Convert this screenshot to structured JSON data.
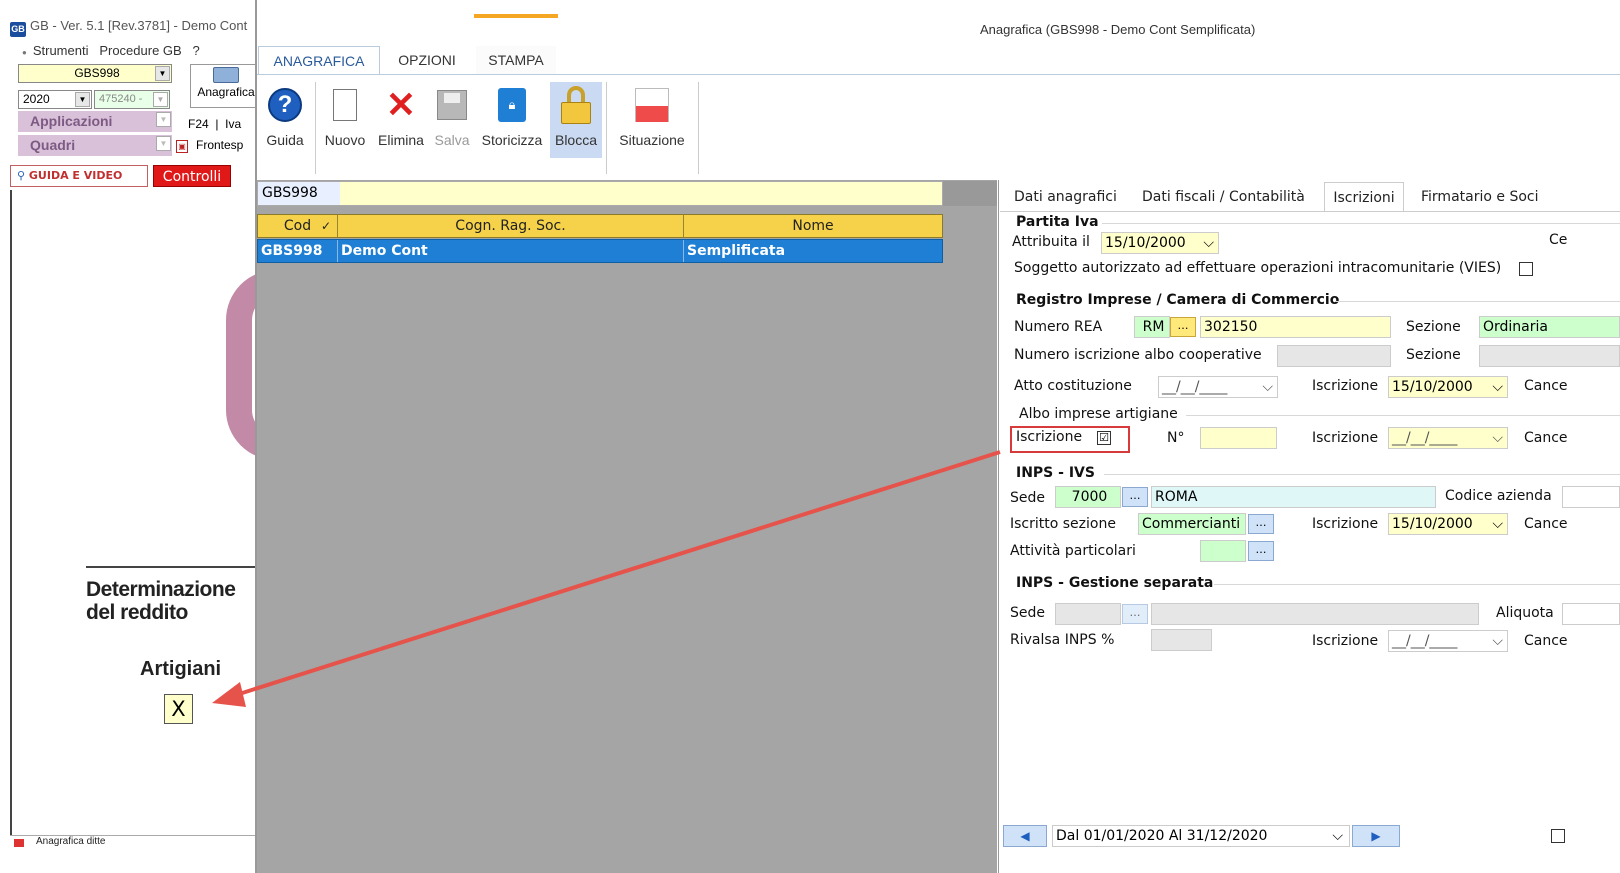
{
  "left_window": {
    "title": "GB - Ver. 5.1 [Rev.3781] - Demo Cont",
    "menu": [
      "Strumenti",
      "Procedure GB",
      "?"
    ],
    "company_select": "GBS998",
    "year_select": "2020",
    "code_select": "475240 -",
    "anagrafica_label": "Anagrafica",
    "applicazioni_label": "Applicazioni",
    "quadri_label": "Quadri",
    "f24_label": "F24",
    "iva_label": "Iva",
    "frontespizio_label": "Frontesp",
    "guida_video_label": "GUIDA E VIDEO",
    "controlli_label": "Controlli",
    "doc": {
      "heading": "Determinazione del reddito",
      "artigiani_label": "Artigiani",
      "artigiani_value": "X"
    },
    "status_label": "Anagrafica ditte"
  },
  "main_window": {
    "title": "Anagrafica (GBS998 - Demo Cont Semplificata)",
    "tabs": [
      "ANAGRAFICA",
      "OPZIONI",
      "STAMPA"
    ],
    "ribbon": {
      "guida": "Guida",
      "nuovo": "Nuovo",
      "elimina": "Elimina",
      "salva": "Salva",
      "storicizza": "Storicizza",
      "blocca": "Blocca",
      "situazione": "Situazione"
    },
    "search_value": "GBS998",
    "grid": {
      "columns": [
        "Cod",
        "Cogn. Rag. Soc.",
        "Nome"
      ],
      "rows": [
        [
          "GBS998",
          "Demo Cont",
          "Semplificata"
        ]
      ]
    }
  },
  "detail": {
    "tabs": [
      "Dati anagrafici",
      "Dati fiscali / Contabilità",
      "Iscrizioni",
      "Firmatario e Soci"
    ],
    "partita_iva": {
      "title": "Partita Iva",
      "attribuita_label": "Attribuita il",
      "attribuita_value": "15/10/2000",
      "ce_label": "Ce",
      "vies_label": "Soggetto autorizzato ad effettuare operazioni intracomunitarie (VIES)"
    },
    "registro": {
      "title": "Registro Imprese / Camera di Commercio",
      "rea_label": "Numero REA",
      "rea_prov": "RM",
      "rea_number": "302150",
      "sezione_label": "Sezione",
      "sezione_value": "Ordinaria",
      "albo_coop_label": "Numero iscrizione albo cooperative",
      "sezione2_label": "Sezione",
      "atto_label": "Atto costituzione",
      "atto_value": "__/__/____",
      "iscrizione_label": "Iscrizione",
      "iscrizione_value": "15/10/2000",
      "cance_label": "Cance"
    },
    "albo": {
      "title": "Albo imprese artigiane",
      "iscrizione_label": "Iscrizione",
      "iscrizione_checked": "☑",
      "numero_label": "N°",
      "iscrizione_date_label": "Iscrizione",
      "iscrizione_date_value": "__/__/____",
      "cance_label": "Cance"
    },
    "inps_ivs": {
      "title": "INPS - IVS",
      "sede_label": "Sede",
      "sede_code": "7000",
      "sede_name": "ROMA",
      "codice_azienda_label": "Codice azienda",
      "iscritto_label": "Iscritto sezione",
      "iscritto_value": "Commercianti",
      "iscrizione_label": "Iscrizione",
      "iscrizione_value": "15/10/2000",
      "cance_label": "Cance",
      "attivita_label": "Attività particolari"
    },
    "inps_gs": {
      "title": "INPS - Gestione separata",
      "sede_label": "Sede",
      "aliquota_label": "Aliquota",
      "rivalsa_label": "Rivalsa INPS %",
      "iscrizione_label": "Iscrizione",
      "iscrizione_value": "__/__/____",
      "cance_label": "Cance"
    },
    "period": "Dal 01/01/2020 Al 31/12/2020"
  },
  "colors": {
    "selected_row": "#1e7fd4",
    "header_yellow": "#f5d24a",
    "highlight_red": "#d63a3a",
    "arrow": "#e5534b"
  }
}
